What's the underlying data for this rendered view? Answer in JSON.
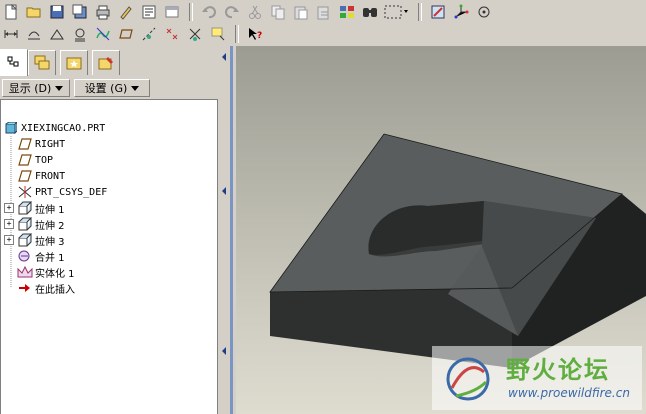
{
  "toolbar": {
    "row1_icons": [
      "new-icon",
      "open-icon",
      "save-icon",
      "save-copy-icon",
      "print-icon",
      "edit-icon",
      "model-tree-icon",
      "undo-icon",
      "redo-icon",
      "cut-icon",
      "copy-icon",
      "paste-icon",
      "paste-special-icon",
      "regenerate-icon",
      "find-icon",
      "select-box-icon",
      "datum-display-icon",
      "csys-icon",
      "spin-center-icon",
      "plane-display-icon"
    ],
    "row2_icons": [
      "dimension-icon",
      "surface-finish-icon",
      "geometric-tolerance-icon",
      "datum-feature-icon",
      "sketch-icon",
      "datum-plane-icon",
      "axis-display-icon",
      "point-display-icon",
      "csys-display-icon",
      "annotation-icon",
      "whats-this-icon"
    ]
  },
  "nav_tabs": [
    "model-tree-tab",
    "layer-tab",
    "favorites-tab",
    "folder-tab"
  ],
  "dropdowns": {
    "show_label": "显示 (D)",
    "settings_label": "设置 (G)"
  },
  "tree": {
    "root": "XIEXINGCAO.PRT",
    "items": [
      {
        "label": "RIGHT",
        "icon": "datum-plane-icon",
        "expandable": false
      },
      {
        "label": "TOP",
        "icon": "datum-plane-icon",
        "expandable": false
      },
      {
        "label": "FRONT",
        "icon": "datum-plane-icon",
        "expandable": false
      },
      {
        "label": "PRT_CSYS_DEF",
        "icon": "csys-icon",
        "expandable": false
      },
      {
        "label": "拉伸 1",
        "icon": "extrude-icon",
        "expandable": true
      },
      {
        "label": "拉伸 2",
        "icon": "extrude-icon",
        "expandable": true
      },
      {
        "label": "拉伸 3",
        "icon": "extrude-icon",
        "expandable": true
      },
      {
        "label": "合并 1",
        "icon": "merge-icon",
        "expandable": false
      },
      {
        "label": "实体化 1",
        "icon": "solidify-icon",
        "expandable": false
      },
      {
        "label": "在此插入",
        "icon": "insert-here-arrow-icon",
        "expandable": false
      }
    ]
  },
  "watermark": {
    "brand_cn": "野火论坛",
    "url": "www.proewildfire.cn"
  },
  "colors": {
    "viewport_top": "#9c9c92",
    "viewport_bottom": "#dedccf",
    "splitter": "#7b95c2",
    "model_dark": "#3f4242"
  }
}
